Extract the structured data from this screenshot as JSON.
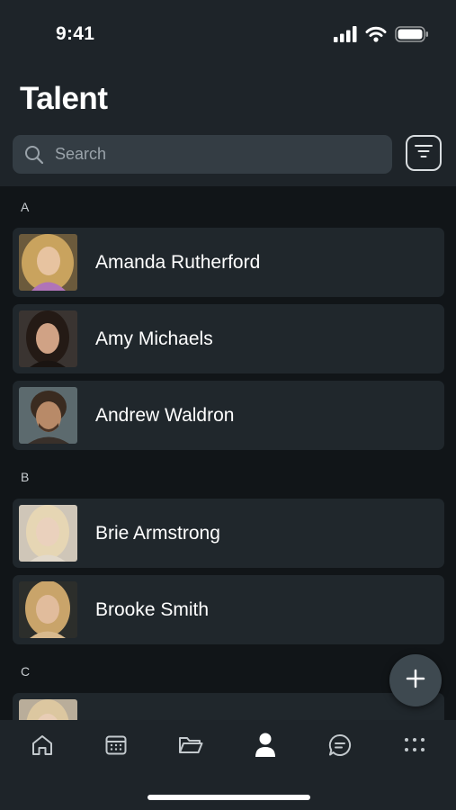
{
  "status_bar": {
    "time": "9:41"
  },
  "header": {
    "title": "Talent"
  },
  "search": {
    "placeholder": "Search"
  },
  "sections": [
    {
      "letter": "A",
      "contacts": [
        {
          "name": "Amanda Rutherford"
        },
        {
          "name": "Amy Michaels"
        },
        {
          "name": "Andrew Waldron"
        }
      ]
    },
    {
      "letter": "B",
      "contacts": [
        {
          "name": "Brie Armstrong"
        },
        {
          "name": "Brooke Smith"
        }
      ]
    },
    {
      "letter": "C",
      "contacts": [
        {
          "name": ""
        }
      ]
    }
  ],
  "tab_bar": {
    "items": [
      {
        "icon": "home-icon"
      },
      {
        "icon": "calendar-icon"
      },
      {
        "icon": "folder-icon"
      },
      {
        "icon": "person-icon",
        "active": true
      },
      {
        "icon": "chat-icon"
      },
      {
        "icon": "more-icon"
      }
    ]
  },
  "fab": {
    "icon": "plus-icon"
  },
  "colors": {
    "background": "#111518",
    "surface": "#20272c",
    "header": "#1e2429",
    "search_field": "#343d44",
    "text": "#ffffff",
    "muted_text": "#9aa3aa"
  }
}
